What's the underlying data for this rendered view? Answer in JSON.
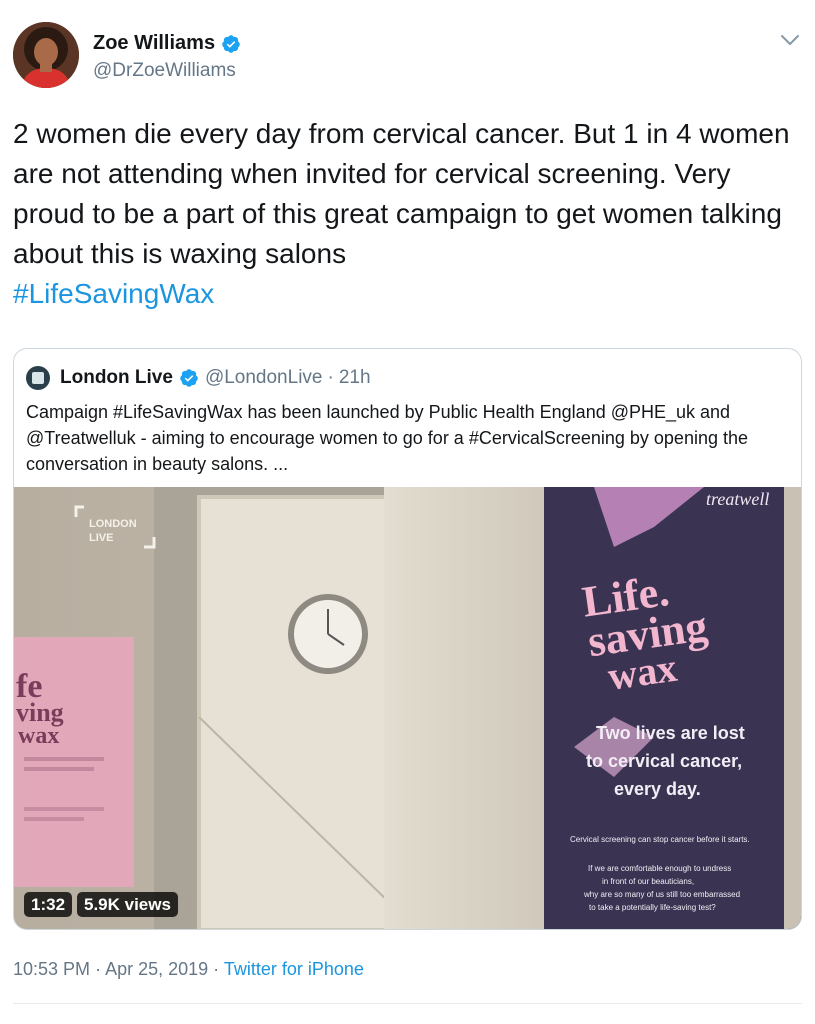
{
  "author": {
    "name": "Zoe Williams",
    "handle": "@DrZoeWilliams",
    "verified": true,
    "avatar_icon": "profile-photo"
  },
  "tweet": {
    "text": "2 women die every day from cervical cancer. But 1 in 4 women are not attending when invited for cervical screening. Very proud to be a part of this great campaign to get women talking about this is waxing salons",
    "hashtag": "#LifeSavingWax"
  },
  "quoted": {
    "name": "London Live",
    "handle": "@LondonLive",
    "separator": "·",
    "time": "21h",
    "text": "Campaign #LifeSavingWax has been launched by Public Health England @PHE_uk and @Treatwelluk - aiming to encourage women to go for a #CervicalScreening by opening the conversation in beauty salons. ...",
    "video": {
      "duration": "1:32",
      "views": "5.9K views",
      "watermark_line1": "LONDON",
      "watermark_line2": "LIVE",
      "poster_brand": "treatwell",
      "poster_title_1": "Life.",
      "poster_title_2": "saving",
      "poster_title_3": "wax",
      "poster_sub_1": "Two lives are lost",
      "poster_sub_2": "to cervical cancer,",
      "poster_sub_3": "every day.",
      "poster_small": "Cervical screening can stop cancer before it starts.",
      "poster_body_1": "If we are comfortable enough to undress",
      "poster_body_2": "in front of our beauticians,",
      "poster_body_3": "why are so many of us still too embarrassed",
      "poster_body_4": "to take a potentially life-saving test?",
      "left_poster_1": "fe",
      "left_poster_2": "ving",
      "left_poster_3": "wax"
    }
  },
  "meta": {
    "time": "10:53 PM",
    "dot1": "·",
    "date": "Apr 25, 2019",
    "dot2": "·",
    "source": "Twitter for iPhone"
  },
  "colors": {
    "link": "#1b95e0",
    "verified": "#1da1f2",
    "secondary": "#657786",
    "poster_purple": "#3a3352"
  }
}
